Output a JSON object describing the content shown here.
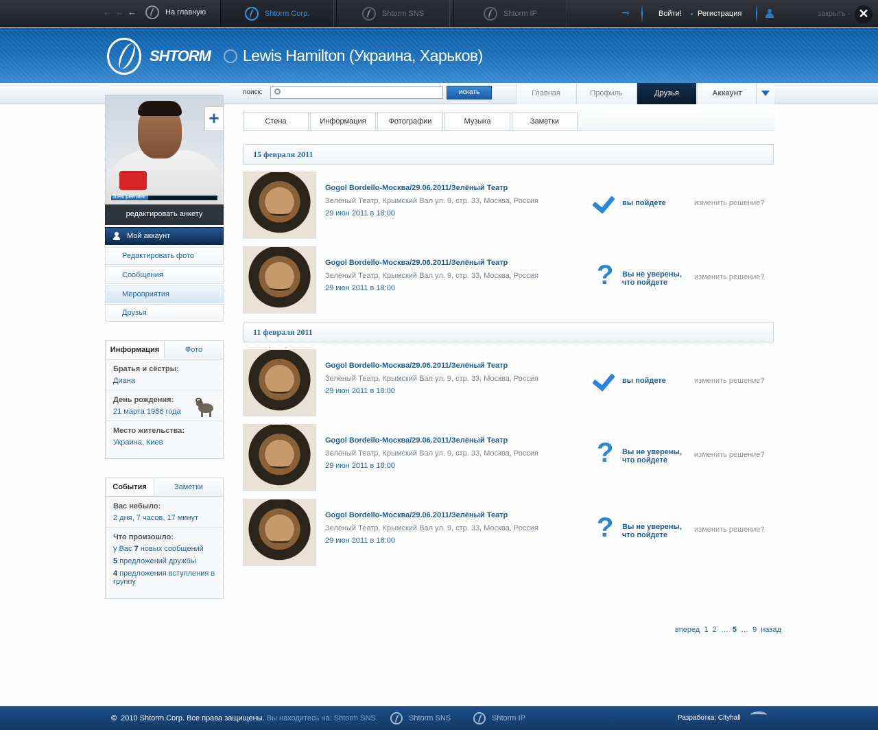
{
  "topbar": {
    "home_label": "На главную",
    "tabs": [
      {
        "label": "Shtorm Corp.",
        "active": true
      },
      {
        "label": "Shtorm SNS",
        "active": false
      },
      {
        "label": "Shtorm IP",
        "active": false
      }
    ],
    "login": "Войти!",
    "register": "Регистрация",
    "close_label": "закрыть -",
    "close_icon": "✕",
    "accent_color": "#2e94e6"
  },
  "header": {
    "brand": "SHTORM",
    "page_title": "Lewis Hamilton (Украина, Харьков)"
  },
  "search": {
    "label": "поиск:",
    "placeholder": "",
    "button": "искать"
  },
  "nav": {
    "tabs": [
      {
        "label": "Главная",
        "active": false
      },
      {
        "label": "Профиль",
        "active": false
      },
      {
        "label": "Друзья",
        "active": true
      },
      {
        "label": "Аккаунт",
        "active": false
      }
    ]
  },
  "profile": {
    "rating_label": "35% рейтинг",
    "rating_fraction": 0.35,
    "edit_label": "редактировать анкету",
    "add_icon": "+"
  },
  "sidemenu": {
    "account": "Мой аккаунт",
    "items": [
      {
        "label": "Редактировать фото"
      },
      {
        "label": "Сообщения"
      },
      {
        "label": "Мероприятия"
      },
      {
        "label": "Друзья"
      }
    ]
  },
  "info": {
    "tabs": [
      "Информация",
      "Фото"
    ],
    "siblings_label": "Братья и сёстры:",
    "siblings_value": "Диана",
    "birthday_label": "День рождения:",
    "birthday_value": "21 марта 1986 года",
    "birthday_icon": "aries-icon",
    "residence_label": "Место жительства:",
    "residence_value": "Украина, Киев"
  },
  "events_box": {
    "tabs": [
      "События",
      "Заметки"
    ],
    "absent_label": "Вас небыло:",
    "absent_value": "2 дня, 7 часов, 17 минут",
    "happened_label": "Что произошло:",
    "line1_pre": "у Вас",
    "line1_num": "7",
    "line1_post": "новых сообщений",
    "line2_num": "5",
    "line2_post": "предложений дружбы",
    "line3_num": "4",
    "line3_post": "предложения вступления в группу"
  },
  "subtabs": [
    "Стена",
    "Информация",
    "Фотографии",
    "Музыка",
    "Заметки"
  ],
  "groups": [
    {
      "date": "15 февраля 2011",
      "events": [
        {
          "title": "Gogol Bordello-Москва/29.06.2011/Зелёный Театр",
          "address": "Зелёный Театр, Крымский Вал ул. 9, стр. 33, Москва, Россия",
          "date": "29 июн 2011 в 18:00",
          "status": "вы пойдете",
          "status_icon": "check-icon",
          "change": "изменить решение?"
        },
        {
          "title": "Gogol Bordello-Москва/29.06.2011/Зелёный Театр",
          "address": "Зелёный Театр, Крымский Вал ул. 9, стр. 33, Москва, Россия",
          "date": "29 июн 2011 в 18:00",
          "status": "Вы не уверены, что пойдете",
          "status_icon": "question-icon",
          "change": "изменить решение?"
        }
      ]
    },
    {
      "date": "11 февраля 2011",
      "events": [
        {
          "title": "Gogol Bordello-Москва/29.06.2011/Зелёный Театр",
          "address": "Зелёный Театр, Крымский Вал ул. 9, стр. 33, Москва, Россия",
          "date": "29 июн 2011 в 18:00",
          "status": "вы пойдете",
          "status_icon": "check-icon",
          "change": "изменить решение?"
        },
        {
          "title": "Gogol Bordello-Москва/29.06.2011/Зелёный Театр",
          "address": "Зелёный Театр, Крымский Вал ул. 9, стр. 33, Москва, Россия",
          "date": "29 июн 2011 в 18:00",
          "status": "Вы не уверены, что пойдете",
          "status_icon": "question-icon",
          "change": "изменить решение?"
        },
        {
          "title": "Gogol Bordello-Москва/29.06.2011/Зелёный Театр",
          "address": "Зелёный Театр, Крымский Вал ул. 9, стр. 33, Москва, Россия",
          "date": "29 июн 2011 в 18:00",
          "status": "Вы не уверены, что пойдете",
          "status_icon": "question-icon",
          "change": "изменить решение?"
        }
      ]
    }
  ],
  "pager": {
    "forward": "вперед",
    "p1": "1",
    "p2": "2",
    "dots1": "…",
    "current": "5",
    "dots2": "…",
    "last": "9",
    "back": "назад"
  },
  "footer": {
    "copyright_symbol": "©",
    "copyright": "2010 Shtorm.Corp. Все права защищены.",
    "location": "Вы находитесь на: Shtorm SNS.",
    "links": [
      "Shtorm SNS",
      "Shtorm IP"
    ],
    "developer": "Разработка: Cityhall"
  }
}
